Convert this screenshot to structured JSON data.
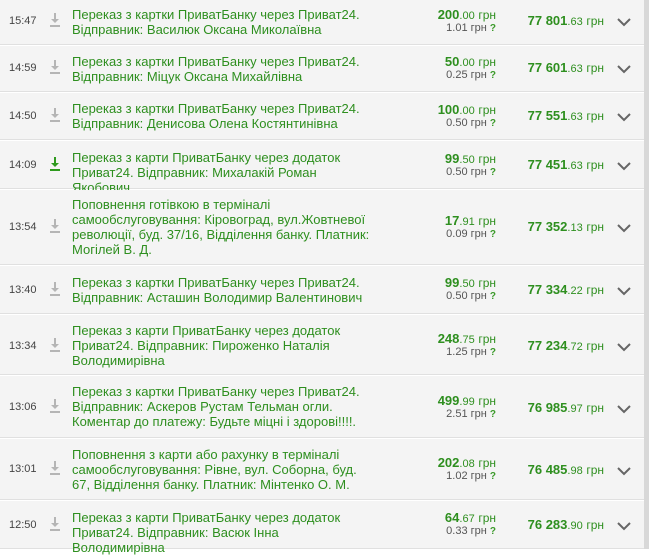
{
  "colors": {
    "accent": "#2e8f1f",
    "row_bg": "#f4f4f4",
    "divider": "#e0e0e0"
  },
  "rows": [
    {
      "time": "15:47",
      "desc": "Переказ з картки ПриватБанку через Приват24. Відправник: Василюк Оксана Миколаївна",
      "amount_int": "200",
      "amount_kop": ".00",
      "currency": "грн",
      "fee": "1.01 грн",
      "balance_int": "77 801",
      "balance_kop": ".63",
      "balance_cur": "грн",
      "icon": "download-icon-gray"
    },
    {
      "time": "14:59",
      "desc": "Переказ з картки ПриватБанку через Приват24. Відправник: Міцук Оксана Михайлівна",
      "amount_int": "50",
      "amount_kop": ".00",
      "currency": "грн",
      "fee": "0.25 грн",
      "balance_int": "77 601",
      "balance_kop": ".63",
      "balance_cur": "грн",
      "icon": "download-icon-gray"
    },
    {
      "time": "14:50",
      "desc": "Переказ з картки ПриватБанку через Приват24. Відправник: Денисова Олена Костянтинівна",
      "amount_int": "100",
      "amount_kop": ".00",
      "currency": "грн",
      "fee": "0.50 грн",
      "balance_int": "77 551",
      "balance_kop": ".63",
      "balance_cur": "грн",
      "icon": "download-icon-gray"
    },
    {
      "time": "14:09",
      "desc": "Переказ з карти ПриватБанку через додаток Приват24. Відправник: Михалакій Роман Якобович",
      "amount_int": "99",
      "amount_kop": ".50",
      "currency": "грн",
      "fee": "0.50 грн",
      "balance_int": "77 451",
      "balance_kop": ".63",
      "balance_cur": "грн",
      "icon": "download-icon-green"
    },
    {
      "time": "13:54",
      "desc": "Поповнення готівкою в терміналі самообслуговування: Кіровоград, вул.Жовтневої революції, буд. 37/16, Відділення банку. Платник: Могілей В. Д.",
      "amount_int": "17",
      "amount_kop": ".91",
      "currency": "грн",
      "fee": "0.09 грн",
      "balance_int": "77 352",
      "balance_kop": ".13",
      "balance_cur": "грн",
      "icon": "download-icon-gray"
    },
    {
      "time": "13:40",
      "desc": "Переказ з картки ПриватБанку через Приват24. Відправник: Асташин Володимир Валентинович",
      "amount_int": "99",
      "amount_kop": ".50",
      "currency": "грн",
      "fee": "0.50 грн",
      "balance_int": "77 334",
      "balance_kop": ".22",
      "balance_cur": "грн",
      "icon": "download-icon-gray"
    },
    {
      "time": "13:34",
      "desc": "Переказ з карти ПриватБанку через додаток Приват24. Відправник: Пироженко Наталія Володимирівна",
      "amount_int": "248",
      "amount_kop": ".75",
      "currency": "грн",
      "fee": "1.25 грн",
      "balance_int": "77 234",
      "balance_kop": ".72",
      "balance_cur": "грн",
      "icon": "download-icon-gray"
    },
    {
      "time": "13:06",
      "desc": "Переказ з картки ПриватБанку через Приват24. Відправник: Аскеров Рустам Тельман огли. Коментар до платежу: Будьте міцні і здорові!!!!.",
      "amount_int": "499",
      "amount_kop": ".99",
      "currency": "грн",
      "fee": "2.51 грн",
      "balance_int": "76 985",
      "balance_kop": ".97",
      "balance_cur": "грн",
      "icon": "download-icon-gray"
    },
    {
      "time": "13:01",
      "desc": "Поповнення з карти або рахунку в терміналі самообслуговування: Рівне, вул. Соборна, буд. 67, Відділення банку. Платник: Мінтенко О. М.",
      "amount_int": "202",
      "amount_kop": ".08",
      "currency": "грн",
      "fee": "1.02 грн",
      "balance_int": "76 485",
      "balance_kop": ".98",
      "balance_cur": "грн",
      "icon": "download-icon-gray"
    },
    {
      "time": "12:50",
      "desc": "Переказ з карти ПриватБанку через додаток Приват24. Відправник: Васюк Інна Володимирівна",
      "amount_int": "64",
      "amount_kop": ".67",
      "currency": "грн",
      "fee": "0.33 грн",
      "balance_int": "76 283",
      "balance_kop": ".90",
      "balance_cur": "грн",
      "icon": "download-icon-gray"
    }
  ]
}
